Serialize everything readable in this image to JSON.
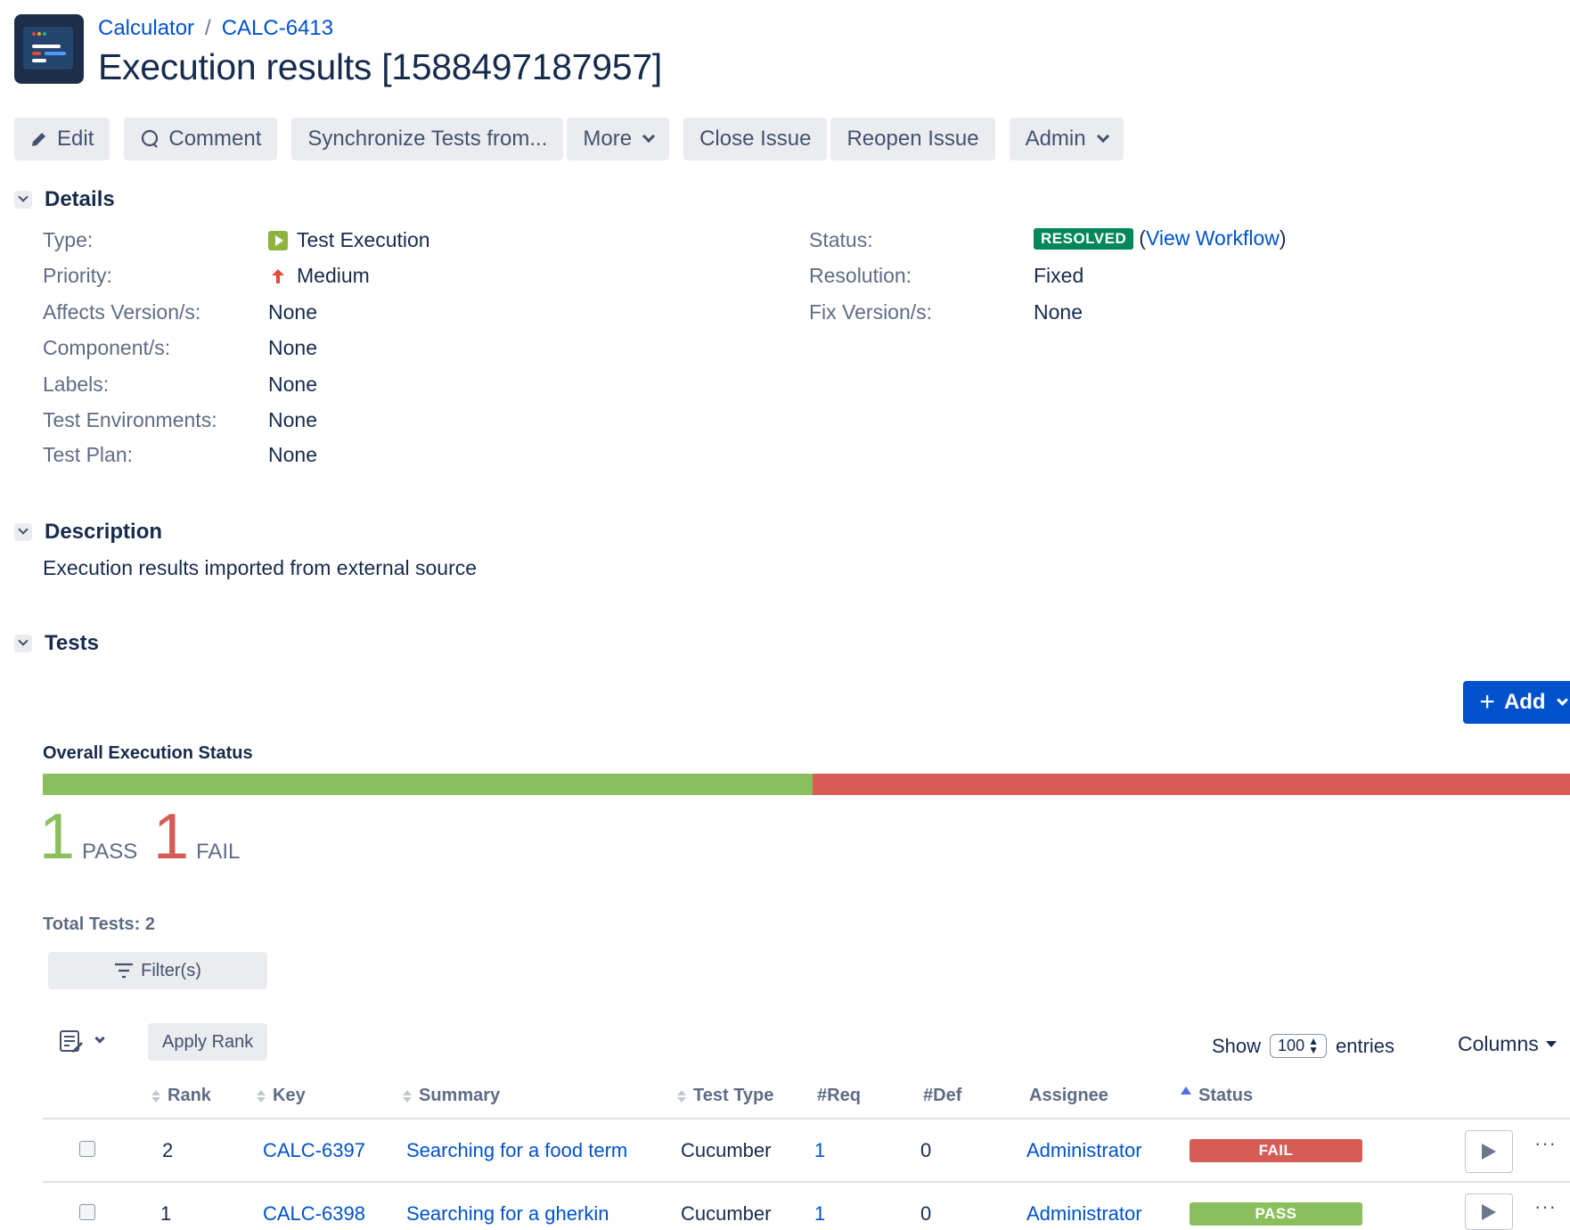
{
  "breadcrumb": {
    "project": "Calculator",
    "separator": "/",
    "issue_key": "CALC-6413"
  },
  "title": "Execution results [1588497187957]",
  "toolbar": {
    "edit": "Edit",
    "comment": "Comment",
    "synchronize": "Synchronize Tests from...",
    "more": "More",
    "close_issue": "Close Issue",
    "reopen_issue": "Reopen Issue",
    "admin": "Admin"
  },
  "details": {
    "heading": "Details",
    "left": [
      {
        "label": "Type:",
        "value": "Test Execution",
        "icon": "test-execution-icon"
      },
      {
        "label": "Priority:",
        "value": "Medium",
        "icon": "priority-medium-icon"
      },
      {
        "label": "Affects Version/s:",
        "value": "None"
      },
      {
        "label": "Component/s:",
        "value": "None"
      },
      {
        "label": "Labels:",
        "value": "None"
      },
      {
        "label": "Test Environments:",
        "value": "None"
      },
      {
        "label": "Test Plan:",
        "value": "None"
      }
    ],
    "right": {
      "status_label": "Status:",
      "status_value": "RESOLVED",
      "view_workflow": "View Workflow",
      "paren_open": "(",
      "paren_close": ")",
      "resolution_label": "Resolution:",
      "resolution_value": "Fixed",
      "fix_label": "Fix Version/s:",
      "fix_value": "None"
    }
  },
  "description": {
    "heading": "Description",
    "text": "Execution results imported from external source"
  },
  "tests": {
    "heading": "Tests",
    "add_label": "Add",
    "overall_label": "Overall Execution Status",
    "progress": {
      "pass_fraction": 0.5,
      "fail_fraction": 0.5
    },
    "pass_count": "1",
    "pass_label": "PASS",
    "fail_count": "1",
    "fail_label": "FAIL",
    "total_label": "Total Tests: 2",
    "filter_label": "Filter(s)",
    "apply_rank": "Apply Rank",
    "show_label": "Show",
    "entries_value": "100",
    "entries_label": "entries",
    "columns_label": "Columns",
    "headers": {
      "rank": "Rank",
      "key": "Key",
      "summary": "Summary",
      "test_type": "Test Type",
      "req": "#Req",
      "def": "#Def",
      "assignee": "Assignee",
      "status": "Status"
    },
    "rows": [
      {
        "rank": "2",
        "key": "CALC-6397",
        "summary": "Searching for a food term",
        "test_type": "Cucumber",
        "req": "1",
        "def": "0",
        "assignee": "Administrator",
        "status": "FAIL"
      },
      {
        "rank": "1",
        "key": "CALC-6398",
        "summary": "Searching for a gherkin",
        "test_type": "Cucumber",
        "req": "1",
        "def": "0",
        "assignee": "Administrator",
        "status": "PASS"
      }
    ],
    "more_actions": "···"
  },
  "colors": {
    "pass": "#8bbf5e",
    "fail": "#d65c55",
    "resolved": "#00875a",
    "primary": "#0052cc"
  }
}
